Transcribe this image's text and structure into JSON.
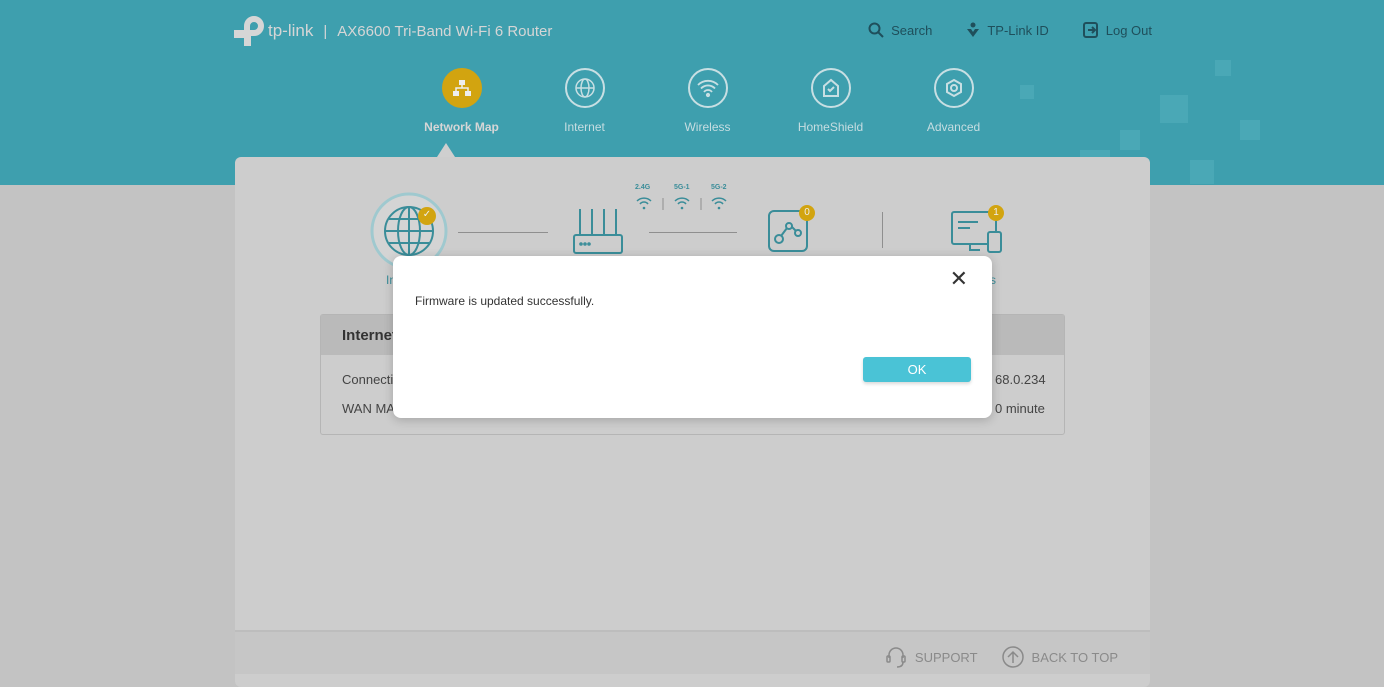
{
  "header": {
    "brand": "tp-link",
    "separator": "|",
    "model": "AX6600 Tri-Band Wi-Fi 6 Router",
    "links": [
      {
        "label": "Search",
        "icon": "search-icon"
      },
      {
        "label": "TP-Link ID",
        "icon": "tplink-id-icon"
      },
      {
        "label": "Log Out",
        "icon": "logout-icon"
      }
    ]
  },
  "nav": {
    "items": [
      {
        "label": "Network Map",
        "icon": "network-map-icon",
        "active": true
      },
      {
        "label": "Internet",
        "icon": "globe-icon"
      },
      {
        "label": "Wireless",
        "icon": "wifi-icon"
      },
      {
        "label": "HomeShield",
        "icon": "homeshield-icon"
      },
      {
        "label": "Advanced",
        "icon": "gear-icon"
      }
    ]
  },
  "map": {
    "bands": [
      "2.4G",
      "5G-1",
      "5G-2"
    ],
    "mesh_badge": "0",
    "clients_badge": "1",
    "internet_label_partial": "In",
    "clients_label_partial": "s"
  },
  "panel": {
    "title": "Internet",
    "rows": [
      {
        "label": "Connecti",
        "value": "68.0.234"
      },
      {
        "label": "WAN MA",
        "value": "0 minute"
      }
    ]
  },
  "modal": {
    "message": "Firmware is updated successfully.",
    "ok_label": "OK",
    "close_label": "✕"
  },
  "footer": {
    "support": "SUPPORT",
    "back_to_top": "BACK TO TOP"
  },
  "colors": {
    "header": "#3e9fae",
    "accent": "#d2a410",
    "ok_button": "#4ac3d6"
  }
}
